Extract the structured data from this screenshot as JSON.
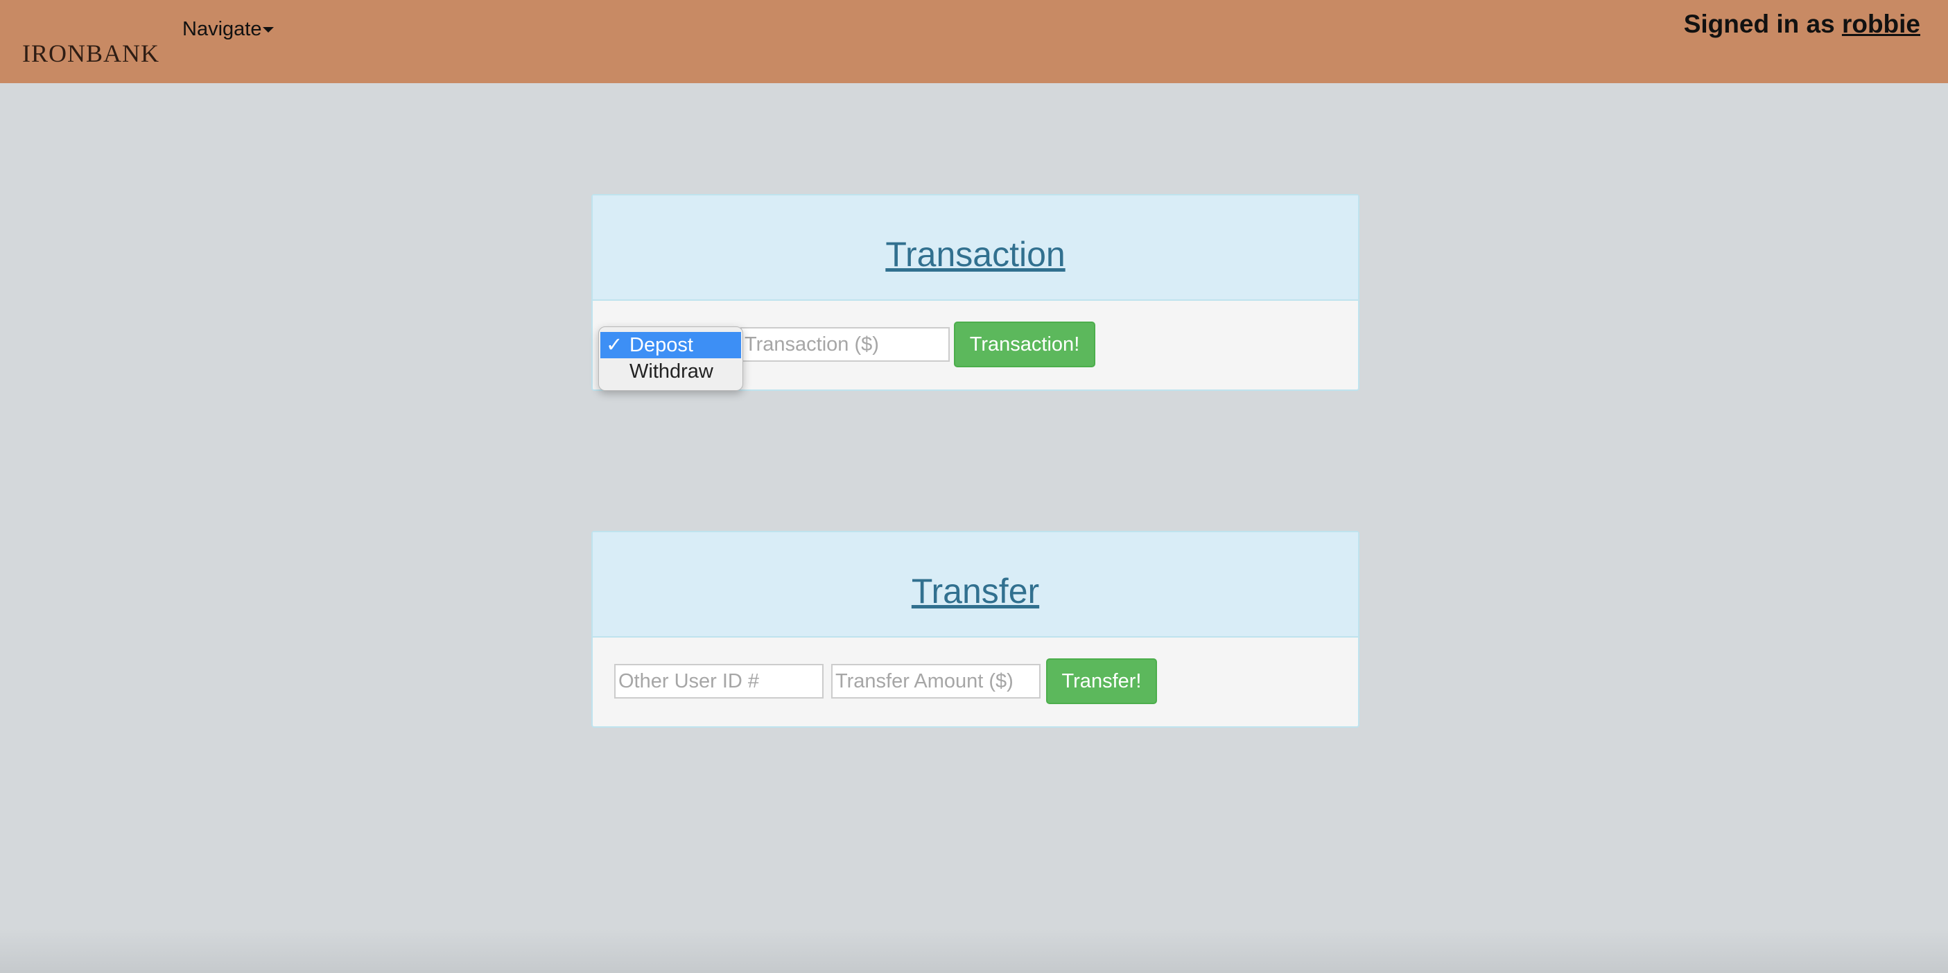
{
  "header": {
    "logo_text": "IRONBANK",
    "nav_label": "Navigate",
    "signed_in_prefix": "Signed in as ",
    "username": "robbie"
  },
  "transaction": {
    "title": "Transaction",
    "type_options": [
      "Depost",
      "Withdraw"
    ],
    "selected_check": "✓",
    "amount_placeholder": "Transaction ($)",
    "submit_label": "Transaction!"
  },
  "transfer": {
    "title": "Transfer",
    "user_id_placeholder": "Other User ID #",
    "amount_placeholder": "Transfer Amount ($)",
    "submit_label": "Transfer!"
  },
  "colors": {
    "navbar": "#c88a64",
    "background": "#d4d8db",
    "panel_heading": "#d9edf7",
    "title_link": "#31708f",
    "success_button": "#5cb85c",
    "select_highlight": "#3d8ff5"
  }
}
